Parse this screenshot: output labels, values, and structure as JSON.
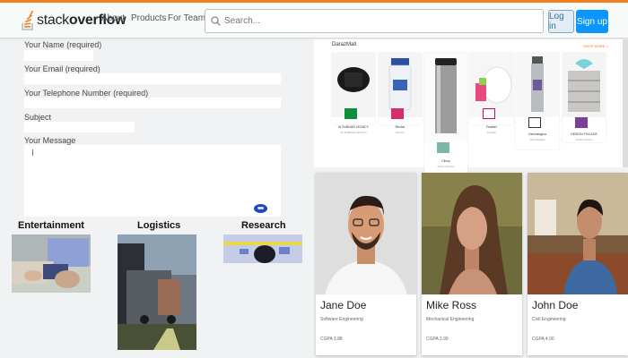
{
  "header": {
    "logo_prefix": "stack",
    "logo_bold": "overflow",
    "nav": [
      "About",
      "Products",
      "For Teams"
    ],
    "search_placeholder": "Search...",
    "login_label": "Log in",
    "signup_label": "Sign up",
    "accent_color": "#f48024",
    "icons": [
      "stack-overflow-logo-icon",
      "search-icon"
    ]
  },
  "form": {
    "name_label": "Your Name (required)",
    "email_label": "Your Email (required)",
    "phone_label": "Your Telephone Number (required)",
    "subject_label": "Subject",
    "message_label": "Your Message"
  },
  "categories": [
    {
      "title": "Entertainment"
    },
    {
      "title": "Logistics"
    },
    {
      "title": "Research"
    }
  ],
  "shop": {
    "title": "DarazMall",
    "more": "SHOP MORE >",
    "products": [
      {
        "name": "Al SUBHAN LEGACY",
        "sub": "AL SUBHAN LEGACY"
      },
      {
        "name": "Revive",
        "sub": "Revive"
      },
      {
        "name": "Clinvy",
        "sub": "Petter Service"
      },
      {
        "name": "Feather",
        "sub": "Feather"
      },
      {
        "name": "Dermalogica",
        "sub": "Dermalogica"
      },
      {
        "name": "DESIGN FOLIAGE",
        "sub": "Textile Factory"
      }
    ]
  },
  "profiles": [
    {
      "name": "Jane Doe",
      "field": "Software Engineering",
      "gpa": "CGPA 3.88"
    },
    {
      "name": "Mike Ross",
      "field": "Mechanical Engineering",
      "gpa": "CGPA 3.99"
    },
    {
      "name": "John Doe",
      "field": "Civil Engineering",
      "gpa": "CGPA 4.00"
    }
  ]
}
